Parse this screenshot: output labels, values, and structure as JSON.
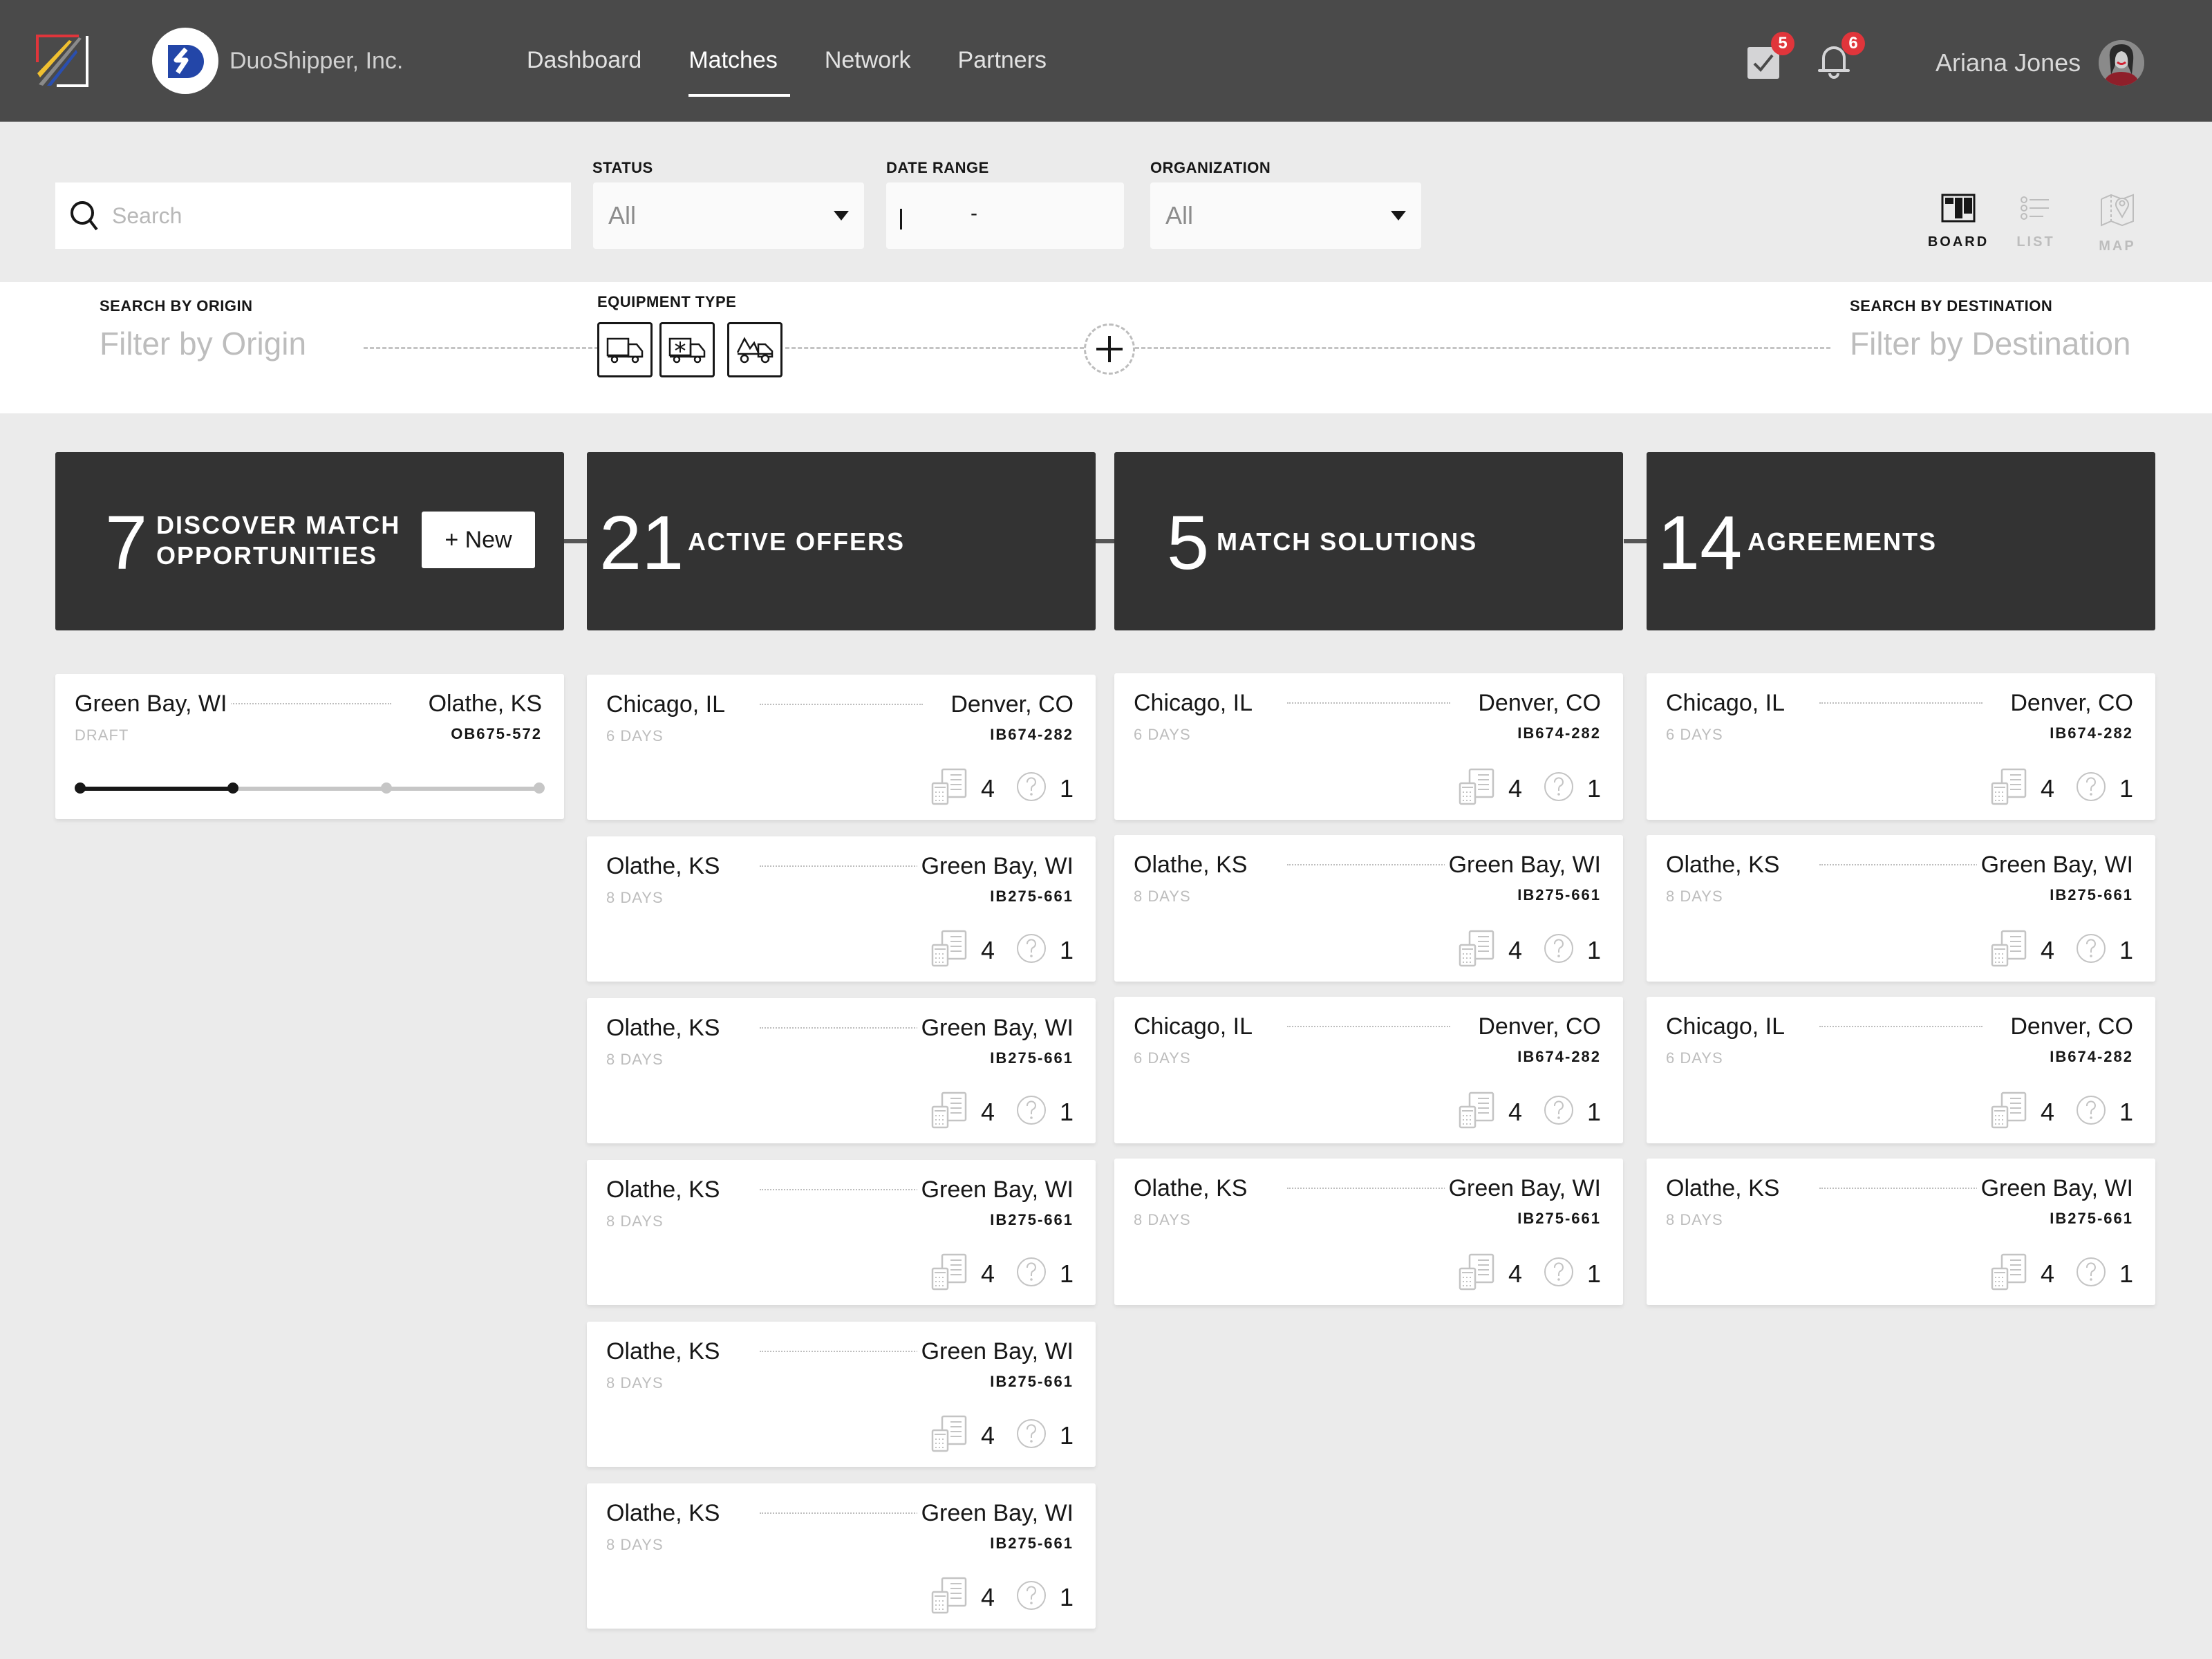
{
  "header": {
    "org_name": "DuoShipper, Inc.",
    "nav": [
      {
        "label": "Dashboard",
        "active": false
      },
      {
        "label": "Matches",
        "active": true
      },
      {
        "label": "Network",
        "active": false
      },
      {
        "label": "Partners",
        "active": false
      }
    ],
    "tasks_badge": "5",
    "notifications_badge": "6",
    "user_name": "Ariana Jones",
    "icons": {
      "tasks": "checklist-icon",
      "notifications": "bell-icon"
    }
  },
  "filters": {
    "search_placeholder": "Search",
    "status": {
      "label": "STATUS",
      "value": "All"
    },
    "date_range": {
      "label": "DATE RANGE",
      "separator": "-"
    },
    "organization": {
      "label": "ORGANIZATION",
      "value": "All"
    },
    "views": [
      {
        "label": "BOARD",
        "active": true
      },
      {
        "label": "LIST",
        "active": false
      },
      {
        "label": "MAP",
        "active": false
      }
    ]
  },
  "route": {
    "origin_label": "SEARCH BY ORIGIN",
    "origin_placeholder": "Filter by Origin",
    "equipment_label": "EQUIPMENT TYPE",
    "equipment": [
      "box-truck",
      "refrigerated-truck",
      "flatbed-truck"
    ],
    "destination_label": "SEARCH BY DESTINATION",
    "destination_placeholder": "Filter by Destination"
  },
  "columns": [
    {
      "count": "7",
      "title_line1": "DISCOVER MATCH",
      "title_line2": "OPPORTUNITIES",
      "new_button": "+ New",
      "cards": [
        {
          "origin": "Green Bay, WI",
          "dest": "Olathe, KS",
          "sub": "DRAFT",
          "ref": "OB675-572",
          "progress": {
            "steps": 4,
            "completed": 2
          }
        }
      ]
    },
    {
      "count": "21",
      "title": "ACTIVE OFFERS",
      "cards": [
        {
          "origin": "Chicago, IL",
          "dest": "Denver, CO",
          "sub": "6 DAYS",
          "ref": "IB674-282",
          "docs": "4",
          "questions": "1"
        },
        {
          "origin": "Olathe, KS",
          "dest": "Green Bay, WI",
          "sub": "8 DAYS",
          "ref": "IB275-661",
          "docs": "4",
          "questions": "1"
        },
        {
          "origin": "Olathe, KS",
          "dest": "Green Bay, WI",
          "sub": "8 DAYS",
          "ref": "IB275-661",
          "docs": "4",
          "questions": "1"
        },
        {
          "origin": "Olathe, KS",
          "dest": "Green Bay, WI",
          "sub": "8 DAYS",
          "ref": "IB275-661",
          "docs": "4",
          "questions": "1"
        },
        {
          "origin": "Olathe, KS",
          "dest": "Green Bay, WI",
          "sub": "8 DAYS",
          "ref": "IB275-661",
          "docs": "4",
          "questions": "1"
        },
        {
          "origin": "Olathe, KS",
          "dest": "Green Bay, WI",
          "sub": "8 DAYS",
          "ref": "IB275-661",
          "docs": "4",
          "questions": "1"
        }
      ]
    },
    {
      "count": "5",
      "title": "MATCH SOLUTIONS",
      "cards": [
        {
          "origin": "Chicago, IL",
          "dest": "Denver, CO",
          "sub": "6 DAYS",
          "ref": "IB674-282",
          "docs": "4",
          "questions": "1"
        },
        {
          "origin": "Olathe, KS",
          "dest": "Green Bay, WI",
          "sub": "8 DAYS",
          "ref": "IB275-661",
          "docs": "4",
          "questions": "1"
        },
        {
          "origin": "Chicago, IL",
          "dest": "Denver, CO",
          "sub": "6 DAYS",
          "ref": "IB674-282",
          "docs": "4",
          "questions": "1"
        },
        {
          "origin": "Olathe, KS",
          "dest": "Green Bay, WI",
          "sub": "8 DAYS",
          "ref": "IB275-661",
          "docs": "4",
          "questions": "1"
        }
      ]
    },
    {
      "count": "14",
      "title": "AGREEMENTS",
      "cards": [
        {
          "origin": "Chicago, IL",
          "dest": "Denver, CO",
          "sub": "6 DAYS",
          "ref": "IB674-282",
          "docs": "4",
          "questions": "1"
        },
        {
          "origin": "Olathe, KS",
          "dest": "Green Bay, WI",
          "sub": "8 DAYS",
          "ref": "IB275-661",
          "docs": "4",
          "questions": "1"
        },
        {
          "origin": "Chicago, IL",
          "dest": "Denver, CO",
          "sub": "6 DAYS",
          "ref": "IB674-282",
          "docs": "4",
          "questions": "1"
        },
        {
          "origin": "Olathe, KS",
          "dest": "Green Bay, WI",
          "sub": "8 DAYS",
          "ref": "IB275-661",
          "docs": "4",
          "questions": "1"
        }
      ]
    }
  ],
  "colors": {
    "header_bg": "#4a4a4a",
    "column_head_bg": "#333333",
    "badge": "#e0353b",
    "brand_blue": "#2346a8"
  }
}
